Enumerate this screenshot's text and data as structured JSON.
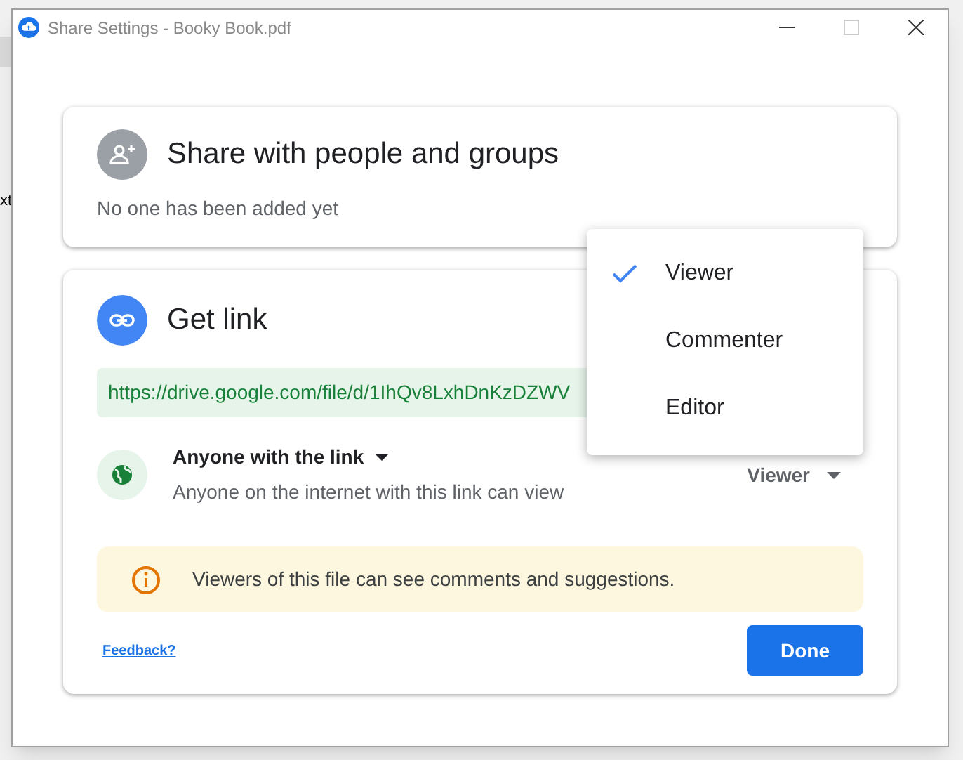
{
  "background_text": "xt",
  "window": {
    "title": "Share Settings - Booky Book.pdf"
  },
  "share_card": {
    "title": "Share with people and groups",
    "status": "No one has been added yet"
  },
  "link_card": {
    "title": "Get link",
    "url": "https://drive.google.com/file/d/1IhQv8LxhDnKzDZWV",
    "access": "Anyone with the link",
    "access_description": "Anyone on the internet with this link can view",
    "role": "Viewer",
    "notice": "Viewers of this file can see comments and suggestions.",
    "feedback": "Feedback?",
    "done": "Done"
  },
  "role_menu": [
    {
      "label": "Viewer",
      "selected": true
    },
    {
      "label": "Commenter",
      "selected": false
    },
    {
      "label": "Editor",
      "selected": false
    }
  ]
}
